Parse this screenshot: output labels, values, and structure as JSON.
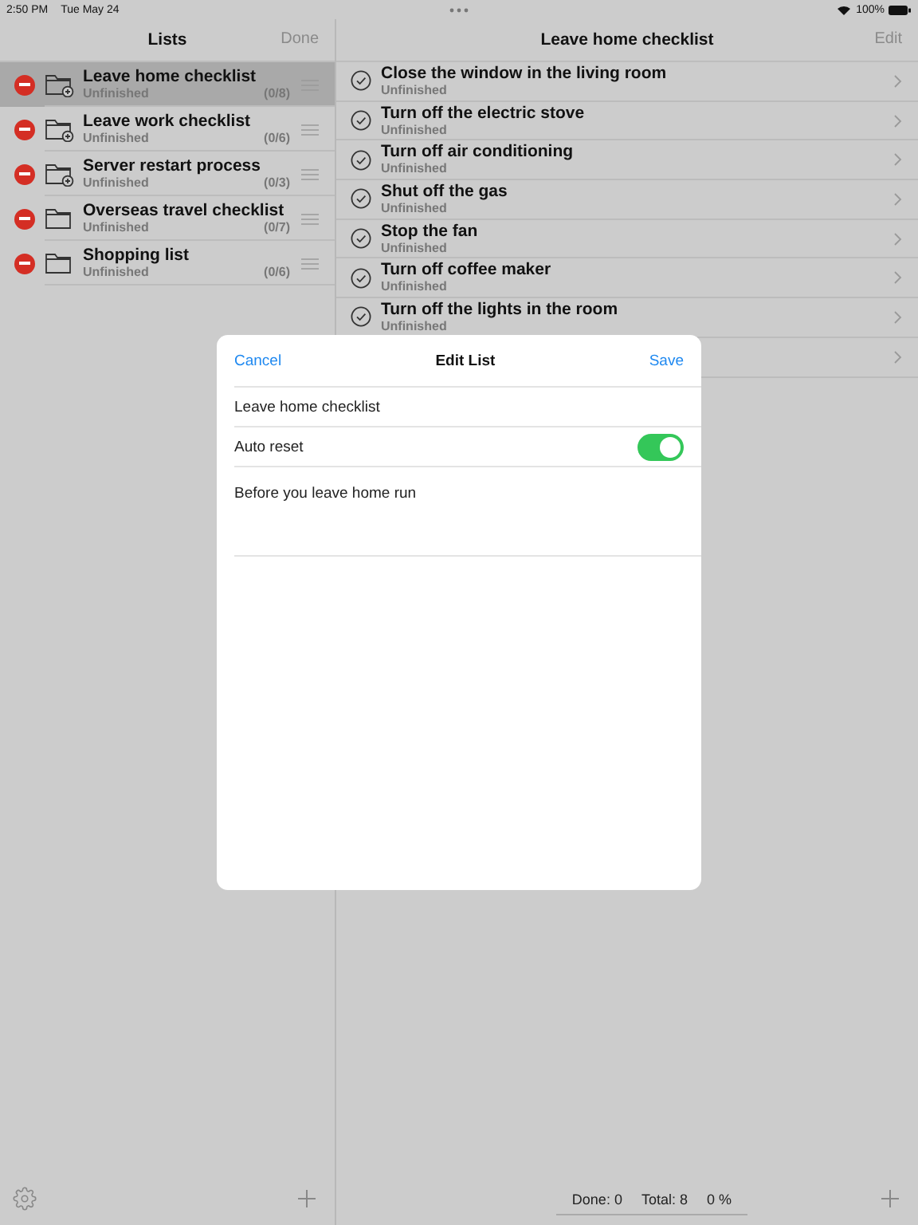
{
  "status_bar": {
    "time": "2:50 PM",
    "date": "Tue May 24",
    "battery": "100%"
  },
  "lists_panel": {
    "title": "Lists",
    "action": "Done",
    "items": [
      {
        "name": "Leave home checklist",
        "status": "Unfinished",
        "count": "(0/8)",
        "kind": "folder-plus",
        "selected": true
      },
      {
        "name": "Leave work checklist",
        "status": "Unfinished",
        "count": "(0/6)",
        "kind": "folder-plus",
        "selected": false
      },
      {
        "name": "Server restart process",
        "status": "Unfinished",
        "count": "(0/3)",
        "kind": "folder-plus",
        "selected": false
      },
      {
        "name": "Overseas travel checklist",
        "status": "Unfinished",
        "count": "(0/7)",
        "kind": "folder",
        "selected": false
      },
      {
        "name": "Shopping list",
        "status": "Unfinished",
        "count": "(0/6)",
        "kind": "folder",
        "selected": false
      }
    ]
  },
  "detail_panel": {
    "title": "Leave home checklist",
    "action": "Edit",
    "tasks": [
      {
        "kind": "task",
        "name": "Close the window in the living room",
        "status": "Unfinished"
      },
      {
        "kind": "task",
        "name": "Turn off the electric stove",
        "status": "Unfinished"
      },
      {
        "kind": "task",
        "name": "Turn off air conditioning",
        "status": "Unfinished"
      },
      {
        "kind": "task",
        "name": "Shut off the gas",
        "status": "Unfinished"
      },
      {
        "kind": "task",
        "name": "Stop the fan",
        "status": "Unfinished"
      },
      {
        "kind": "task",
        "name": "Turn off coffee maker",
        "status": "Unfinished"
      },
      {
        "kind": "task",
        "name": "Turn off the lights in the room",
        "status": "Unfinished"
      },
      {
        "kind": "covered"
      }
    ],
    "footer": {
      "done": "Done: 0",
      "total": "Total: 8",
      "percent": "0 %"
    }
  },
  "dialog": {
    "cancel": "Cancel",
    "title": "Edit List",
    "save": "Save",
    "name_value": "Leave home checklist",
    "auto_reset_label": "Auto reset",
    "auto_reset_on": true,
    "notes_value": "Before you leave home run"
  }
}
